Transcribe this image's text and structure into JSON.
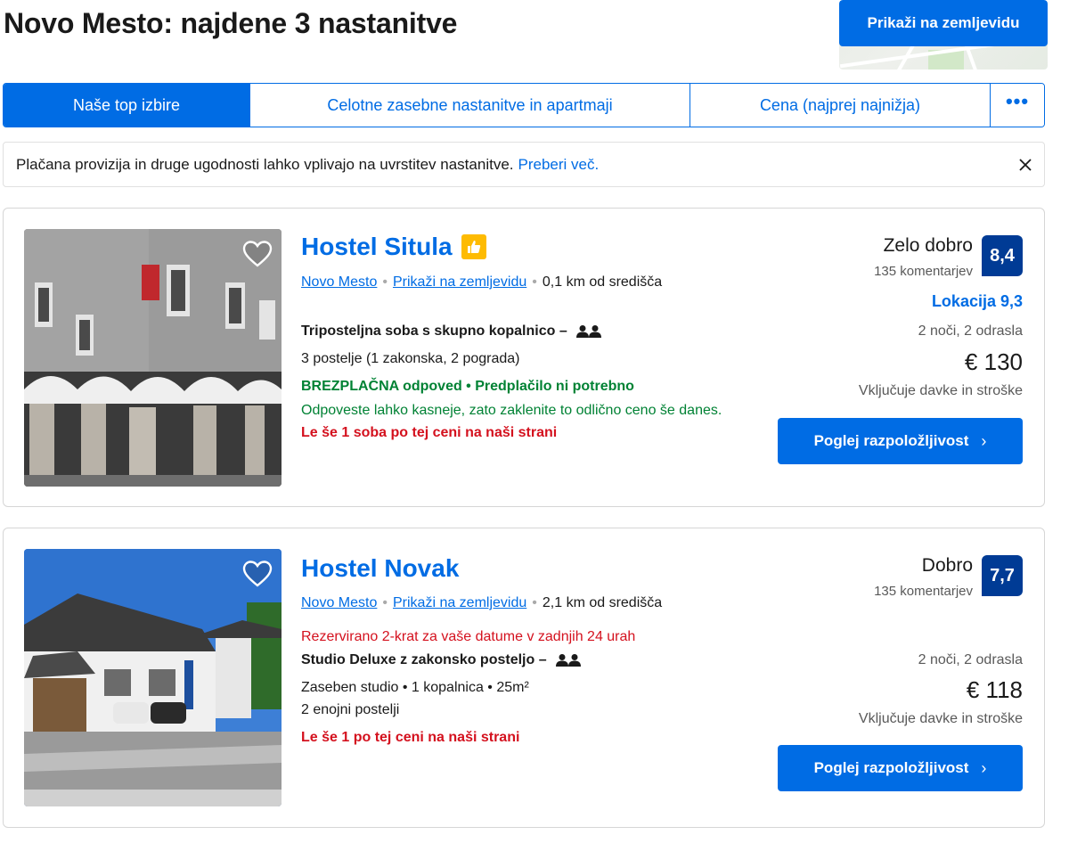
{
  "header": {
    "title": "Novo Mesto: najdene 3 nastanitve",
    "map_button": "Prikaži na zemljevidu"
  },
  "tabs": [
    {
      "label": "Naše top izbire",
      "active": true
    },
    {
      "label": "Celotne zasebne nastanitve in apartmaji",
      "active": false
    },
    {
      "label": "Cena (najprej najnižja)",
      "active": false
    },
    {
      "label": "•••",
      "active": false
    }
  ],
  "notice": {
    "text": "Plačana provizija in druge ugodnosti lahko vplivajo na uvrstitev nastanitve.",
    "link": "Preberi več."
  },
  "properties": [
    {
      "name": "Hostel Situla",
      "city": "Novo Mesto",
      "map_link": "Prikaži na zemljevidu",
      "distance": "0,1 km od središča",
      "room_type": "Triposteljna soba s skupno kopalnico",
      "dash": "–",
      "beds": "3 postelje (1 zakonska, 2 pograda)",
      "cancellation": "BREZPLAČNA odpoved • Predplačilo ni potrebno",
      "cancellation_note": "Odpoveste lahko kasneje, zato zaklenite to odlično ceno še danes.",
      "scarcity": "Le še 1 soba po tej ceni na naši strani",
      "rating_word": "Zelo dobro",
      "reviews": "135 komentarjev",
      "score": "8,4",
      "location_score": "Lokacija 9,3",
      "nights": "2 noči, 2 odrasla",
      "price": "€ 130",
      "taxes": "Vključuje davke in stroške",
      "cta": "Poglej razpoložljivost"
    },
    {
      "name": "Hostel Novak",
      "city": "Novo Mesto",
      "map_link": "Prikaži na zemljevidu",
      "distance": "2,1 km od središča",
      "booked": "Rezervirano 2-krat za vaše datume v zadnjih 24 urah",
      "room_type": "Studio Deluxe z zakonsko posteljo",
      "dash": "–",
      "details": "Zaseben studio • 1 kopalnica • 25m²",
      "beds": "2 enojni postelji",
      "scarcity": "Le še 1 po tej ceni na naši strani",
      "rating_word": "Dobro",
      "reviews": "135 komentarjev",
      "score": "7,7",
      "nights": "2 noči, 2 odrasla",
      "price": "€ 118",
      "taxes": "Vključuje davke in stroške",
      "cta": "Poglej razpoložljivost"
    }
  ]
}
